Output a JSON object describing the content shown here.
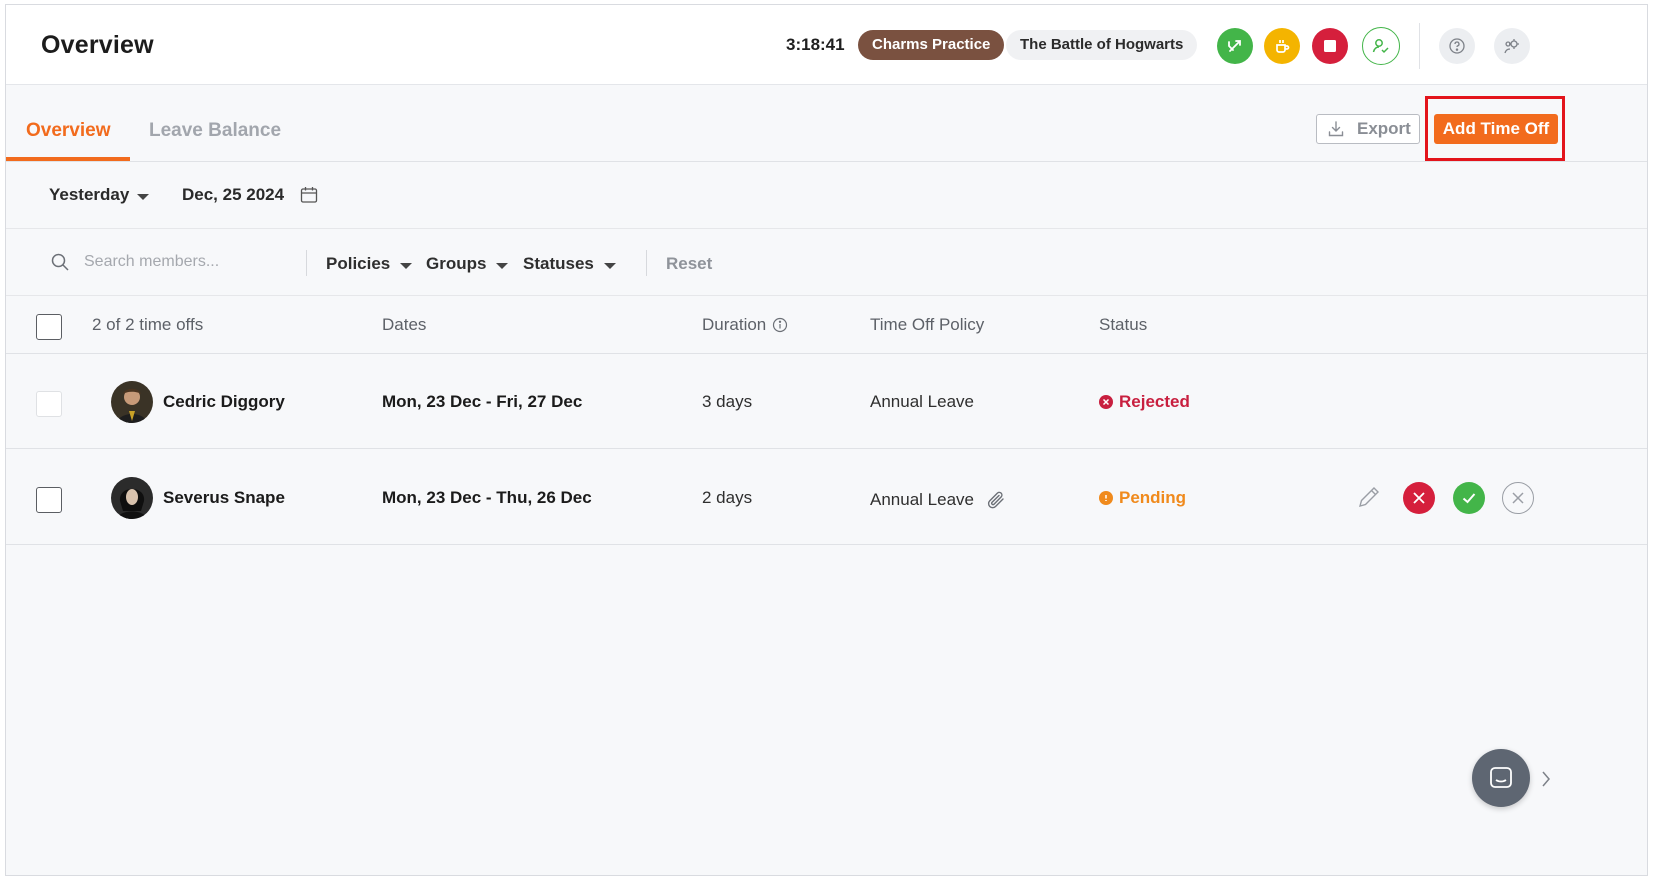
{
  "header": {
    "title": "Overview",
    "timer": "3:18:41",
    "project": "Charms Practice",
    "task": "The Battle of Hogwarts"
  },
  "tabs": [
    {
      "label": "Overview",
      "active": true
    },
    {
      "label": "Leave Balance",
      "active": false
    }
  ],
  "toolbar": {
    "export_label": "Export",
    "add_label": "Add Time Off"
  },
  "date_filter": {
    "range": "Yesterday",
    "date": "Dec, 25 2024"
  },
  "filters": {
    "search_placeholder": "Search members...",
    "policies": "Policies",
    "groups": "Groups",
    "statuses": "Statuses",
    "reset": "Reset"
  },
  "table": {
    "count_label": "2 of 2 time offs",
    "columns": {
      "dates": "Dates",
      "duration": "Duration",
      "policy": "Time Off Policy",
      "status": "Status"
    },
    "rows": [
      {
        "name": "Cedric Diggory",
        "dates": "Mon, 23 Dec - Fri, 27 Dec",
        "duration": "3 days",
        "policy": "Annual Leave",
        "status": "Rejected"
      },
      {
        "name": "Severus Snape",
        "dates": "Mon, 23 Dec - Thu, 26 Dec",
        "duration": "2 days",
        "policy": "Annual Leave",
        "status": "Pending"
      }
    ]
  },
  "colors": {
    "accent": "#f26b1d",
    "rejected": "#c81f3f",
    "pending": "#f08a1c",
    "approve": "#43b549",
    "project_pill": "#7a5140"
  }
}
